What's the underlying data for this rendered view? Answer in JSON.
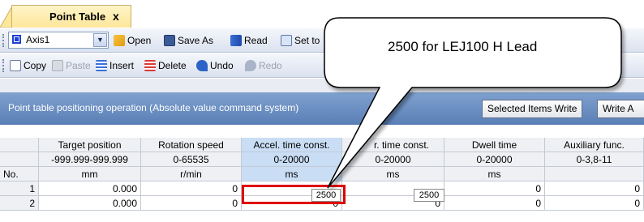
{
  "tab": {
    "title": "Point Table",
    "close": "x"
  },
  "toolbar1": {
    "axis_value": "Axis1",
    "open_label": "Open",
    "save_as_label": "Save As",
    "read_label": "Read",
    "set_to_label": "Set to"
  },
  "toolbar2": {
    "copy_label": "Copy",
    "paste_label": "Paste",
    "insert_label": "Insert",
    "delete_label": "Delete",
    "undo_label": "Undo",
    "redo_label": "Redo"
  },
  "panel": {
    "title": "Point table positioning operation (Absolute value command system)",
    "selected_items_write": "Selected Items Write",
    "write_all": "Write A"
  },
  "table": {
    "no_header": "No.",
    "columns": [
      {
        "name": "Target position",
        "range": "-999.999-999.999",
        "unit": "mm"
      },
      {
        "name": "Rotation speed",
        "range": "0-65535",
        "unit": "r/min"
      },
      {
        "name": "Accel. time const.",
        "range": "0-20000",
        "unit": "ms"
      },
      {
        "name": "r. time const.",
        "range": "0-20000",
        "unit": "ms"
      },
      {
        "name": "Dwell time",
        "range": "0-20000",
        "unit": "ms"
      },
      {
        "name": "Auxiliary func.",
        "range": "0-3,8-11",
        "unit": ""
      }
    ],
    "rows": [
      {
        "no": "1",
        "cells": [
          "0.000",
          "0",
          "2500",
          "2500",
          "0",
          "0"
        ]
      },
      {
        "no": "2",
        "cells": [
          "0.000",
          "0",
          "0",
          "0",
          "0",
          "0"
        ]
      }
    ]
  },
  "callout": {
    "text": "2500 for LEJ100 H Lead"
  },
  "colors": {
    "highlight": "#e00000",
    "panel": "#5a7fb6",
    "tab": "#fde79a"
  }
}
